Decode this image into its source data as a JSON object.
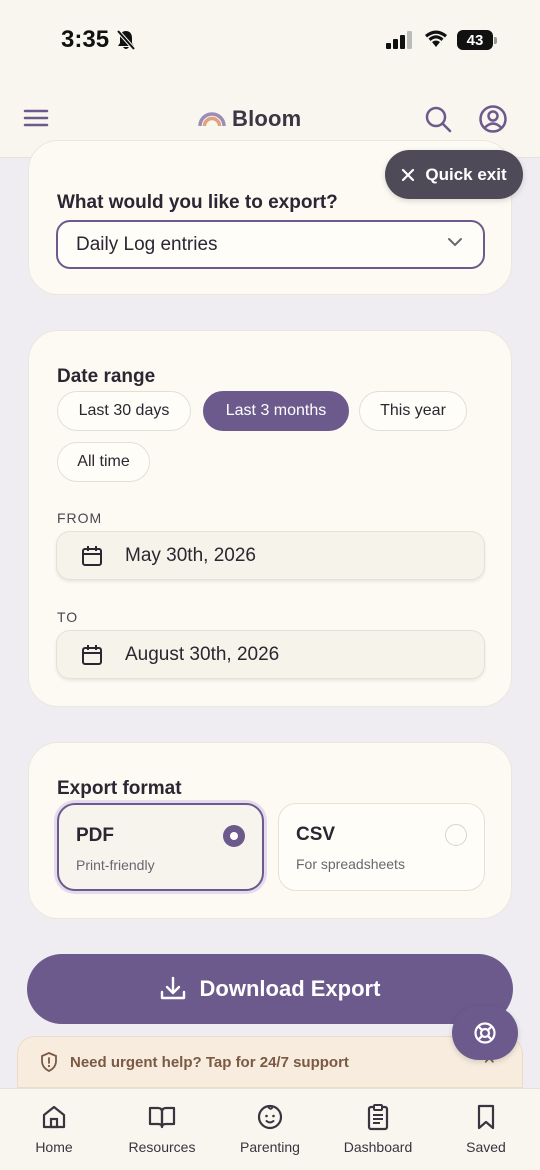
{
  "status": {
    "time": "3:35",
    "battery": "43"
  },
  "header": {
    "brand": "Bloom"
  },
  "quick_exit": {
    "label": "Quick exit"
  },
  "export": {
    "question": "What would you like to export?",
    "selected": "Daily Log entries"
  },
  "date_range": {
    "title": "Date range",
    "chips": [
      "Last 30 days",
      "Last 3 months",
      "This year",
      "All time"
    ],
    "active_chip": "Last 3 months",
    "from_label": "FROM",
    "from_value": "May 30th, 2026",
    "to_label": "TO",
    "to_value": "August 30th, 2026"
  },
  "format": {
    "title": "Export format",
    "options": [
      {
        "title": "PDF",
        "subtitle": "Print-friendly",
        "selected": true
      },
      {
        "title": "CSV",
        "subtitle": "For spreadsheets",
        "selected": false
      }
    ]
  },
  "download": {
    "label": "Download Export"
  },
  "help": {
    "text": "Need urgent help? Tap for 24/7 support"
  },
  "nav": [
    {
      "label": "Home",
      "icon": "home-icon"
    },
    {
      "label": "Resources",
      "icon": "book-icon"
    },
    {
      "label": "Parenting",
      "icon": "baby-face-icon"
    },
    {
      "label": "Dashboard",
      "icon": "clipboard-icon"
    },
    {
      "label": "Saved",
      "icon": "bookmark-icon"
    }
  ],
  "colors": {
    "accent": "#6c5a8d",
    "background": "#efedf2",
    "card": "#fcfaf3",
    "quick_exit": "#4f4a58"
  }
}
